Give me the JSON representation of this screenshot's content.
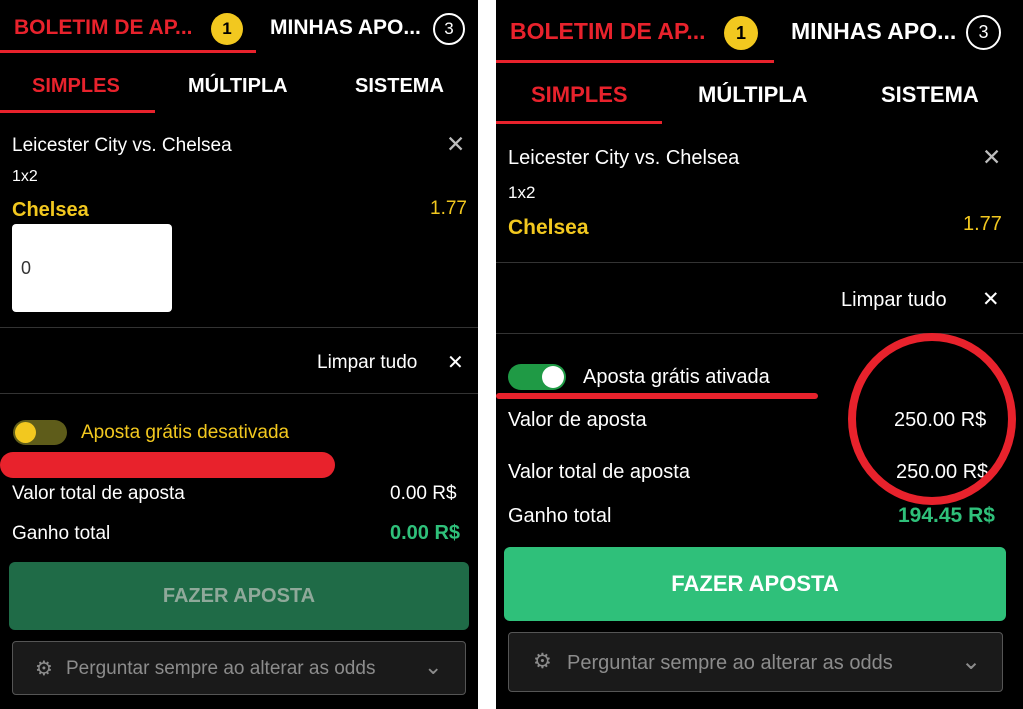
{
  "left": {
    "tab_betslip": "BOLETIM DE AP...",
    "tab_betslip_count": "1",
    "tab_mybets": "MINHAS APO...",
    "tab_mybets_count": "3",
    "subtabs": [
      "SIMPLES",
      "MÚLTIPLA",
      "SISTEMA"
    ],
    "event": "Leicester City vs. Chelsea",
    "market": "1x2",
    "selection": "Chelsea",
    "odds": "1.77",
    "stake_value": "0",
    "clear_all": "Limpar tudo",
    "free_bet_label": "Aposta grátis desativada",
    "total_stake_label": "Valor total de aposta",
    "total_stake_value": "0.00 R$",
    "total_win_label": "Ganho total",
    "total_win_value": "0.00 R$",
    "place_bet": "FAZER APOSTA",
    "odds_change_option": "Perguntar sempre ao alterar as odds"
  },
  "right": {
    "tab_betslip": "BOLETIM DE AP...",
    "tab_betslip_count": "1",
    "tab_mybets": "MINHAS APO...",
    "tab_mybets_count": "3",
    "subtabs": [
      "SIMPLES",
      "MÚLTIPLA",
      "SISTEMA"
    ],
    "event": "Leicester City vs. Chelsea",
    "market": "1x2",
    "selection": "Chelsea",
    "odds": "1.77",
    "clear_all": "Limpar tudo",
    "free_bet_label": "Aposta grátis ativada",
    "stake_label": "Valor de aposta",
    "stake_value": "250.00 R$",
    "total_stake_label": "Valor total de aposta",
    "total_stake_value": "250.00 R$",
    "total_win_label": "Ganho total",
    "total_win_value": "194.45 R$",
    "place_bet": "FAZER APOSTA",
    "odds_change_option": "Perguntar sempre ao alterar as odds"
  },
  "colors": {
    "accent_red": "#e8222c",
    "yellow": "#f2c81f",
    "green": "#2fc07a",
    "disabled_green": "#1f6b47"
  },
  "icons": [
    "close-icon",
    "gear-icon",
    "chevron-down-icon"
  ]
}
